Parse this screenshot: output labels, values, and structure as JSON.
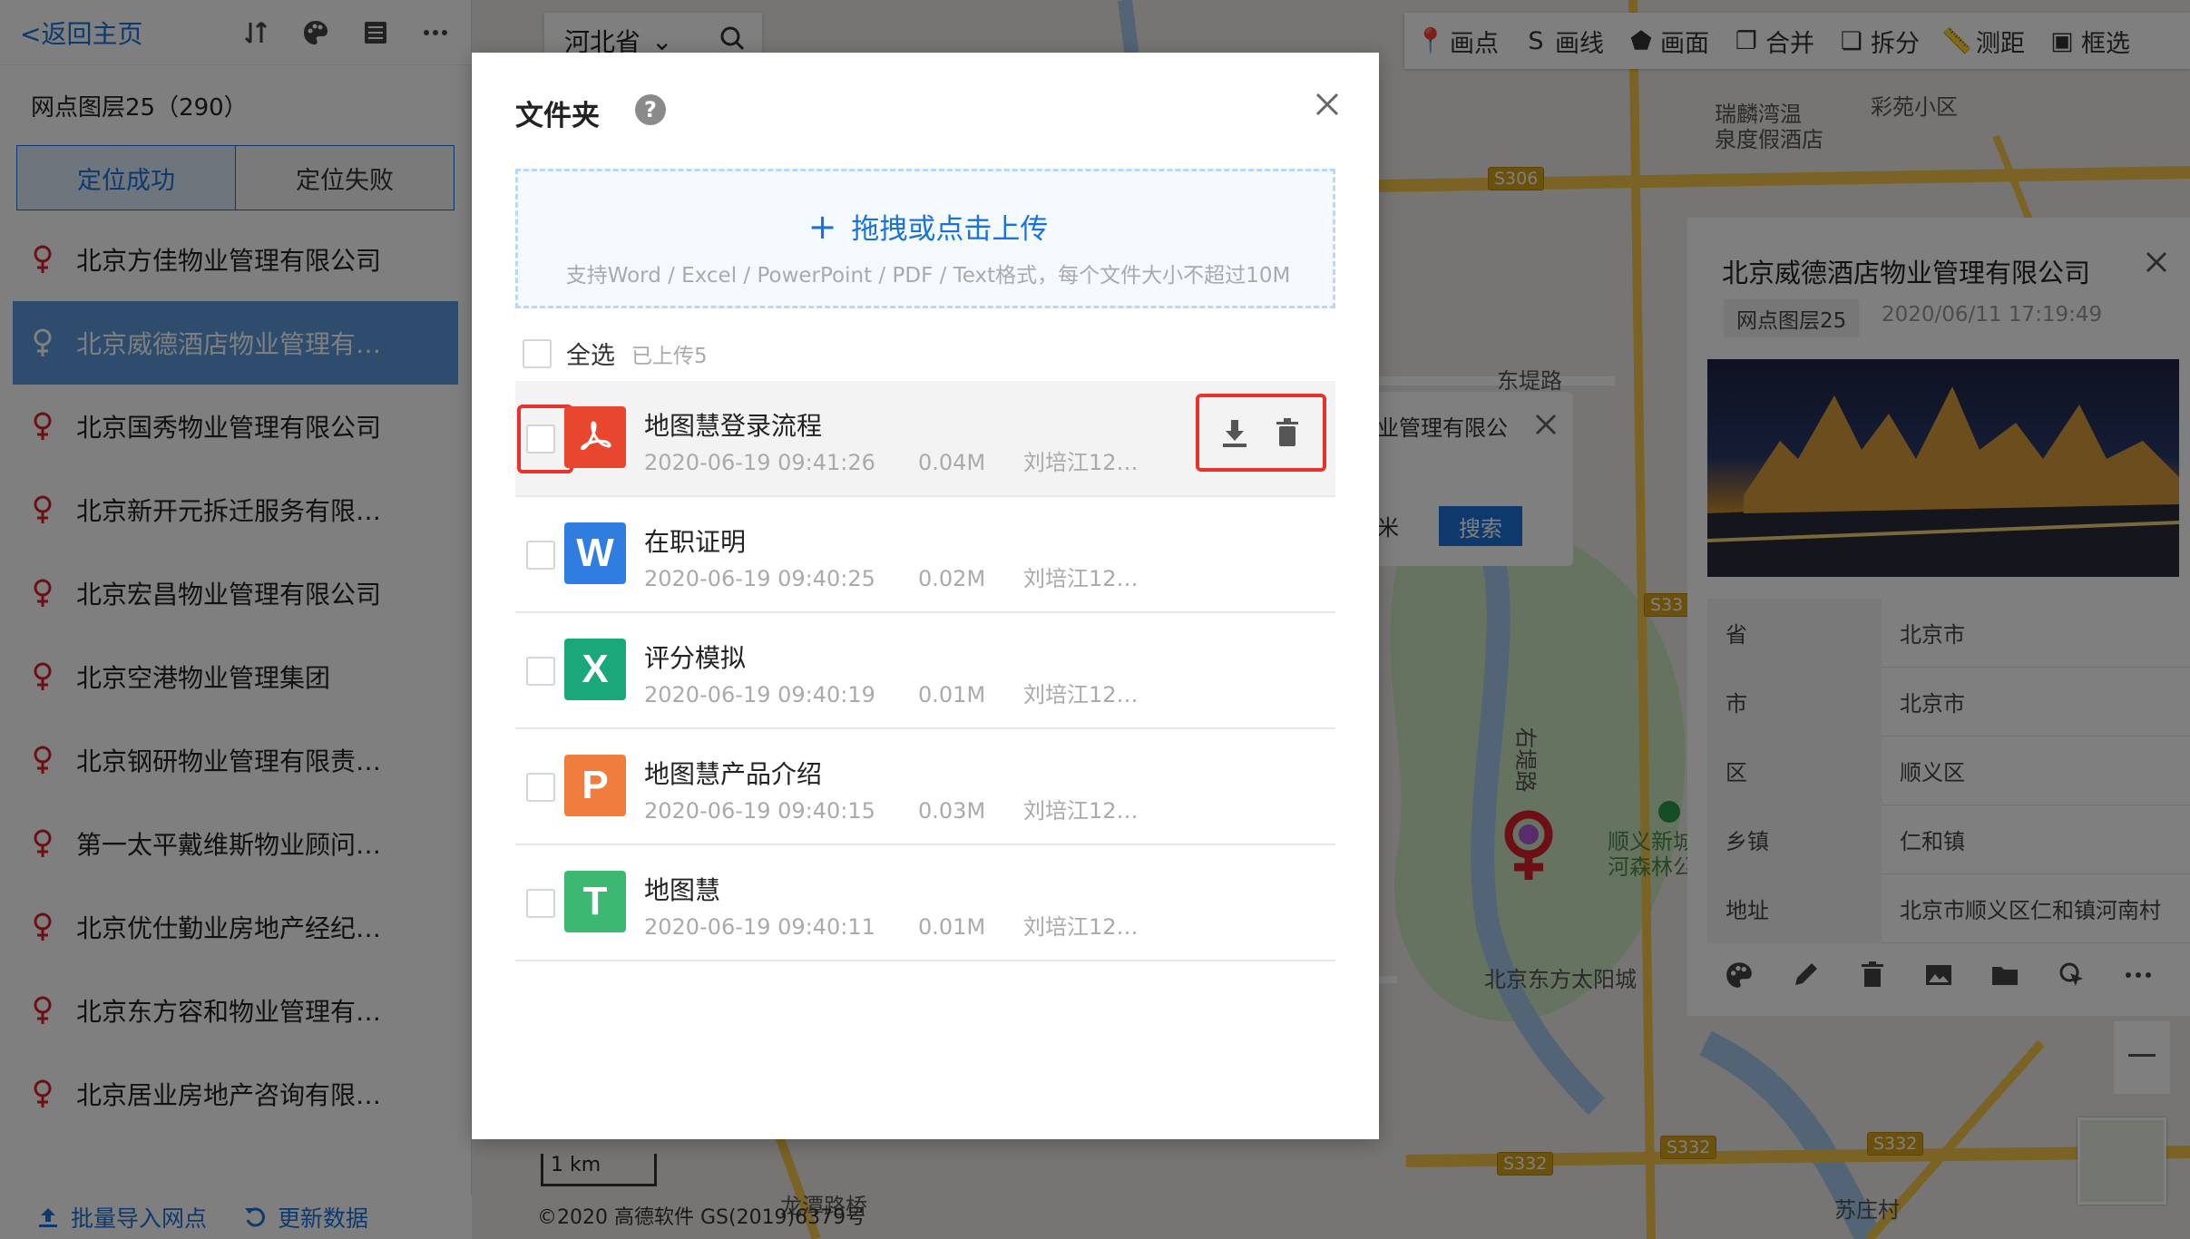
{
  "left_panel": {
    "back_label": "<返回主页",
    "layer_title": "网点图层25（290）",
    "tabs": [
      "定位成功",
      "定位失败"
    ],
    "items": [
      "北京方佳物业管理有限公司",
      "北京威德酒店物业管理有…",
      "北京国秀物业管理有限公司",
      "北京新开元拆迁服务有限…",
      "北京宏昌物业管理有限公司",
      "北京空港物业管理集团",
      "北京钢研物业管理有限责…",
      "第一太平戴维斯物业顾问…",
      "北京优仕勤业房地产经纪…",
      "北京东方容和物业管理有…",
      "北京居业房地产咨询有限…"
    ],
    "import_label": "批量导入网点",
    "refresh_label": "更新数据"
  },
  "province": "河北省",
  "map_toolbar": [
    "画点",
    "画线",
    "画面",
    "合并",
    "拆分",
    "测距",
    "框选"
  ],
  "map_labels": {
    "hotel": "瑞麟湾温\n泉度假酒店",
    "xiaoqu": "彩苑小区",
    "dongdi": "东堤路",
    "youdi": "右堤路",
    "forest": "顺义新城\n河森林公",
    "taiyang": "北京东方太阳城",
    "suzhuang": "苏庄村",
    "longtan": "龙潭路桥",
    "s306": "S306",
    "s332": "S332",
    "s33": "S33"
  },
  "popup": {
    "text": "业管理有限公",
    "unit": "米",
    "search": "搜索"
  },
  "detail": {
    "title": "北京威德酒店物业管理有限公司",
    "layer_tag": "网点图层25",
    "time": "2020/06/11 17:19:49",
    "rows": [
      {
        "k": "省",
        "v": "北京市"
      },
      {
        "k": "市",
        "v": "北京市"
      },
      {
        "k": "区",
        "v": "顺义区"
      },
      {
        "k": "乡镇",
        "v": "仁和镇"
      },
      {
        "k": "地址",
        "v": "北京市顺义区仁和镇河南村"
      }
    ]
  },
  "scale": "1 km",
  "copyright": "©2020 高德软件 GS(2019)6379号",
  "dialog": {
    "title": "文件夹",
    "help": "?",
    "upload_main": "拖拽或点击上传",
    "upload_hint": "支持Word / Excel / PowerPoint / PDF / Text格式，每个文件大小不超过10M",
    "select_all": "全选",
    "uploaded": "已上传5",
    "files": [
      {
        "icon": "pdf",
        "name": "地图慧登录流程",
        "time": "2020-06-19 09:41:26",
        "size": "0.04M",
        "user": "刘培江12…"
      },
      {
        "icon": "W",
        "name": "在职证明",
        "time": "2020-06-19 09:40:25",
        "size": "0.02M",
        "user": "刘培江12…"
      },
      {
        "icon": "X",
        "name": "评分模拟",
        "time": "2020-06-19 09:40:19",
        "size": "0.01M",
        "user": "刘培江12…"
      },
      {
        "icon": "P",
        "name": "地图慧产品介绍",
        "time": "2020-06-19 09:40:15",
        "size": "0.03M",
        "user": "刘培江12…"
      },
      {
        "icon": "T",
        "name": "地图慧",
        "time": "2020-06-19 09:40:11",
        "size": "0.01M",
        "user": "刘培江12…"
      }
    ]
  },
  "colors": {
    "accent": "#1a73d9",
    "pdf": "#e8462f",
    "word": "#2f7de1",
    "excel": "#1aa87a",
    "ppt": "#f07c3d",
    "text": "#3cb873",
    "highlight": "#e8322d"
  }
}
